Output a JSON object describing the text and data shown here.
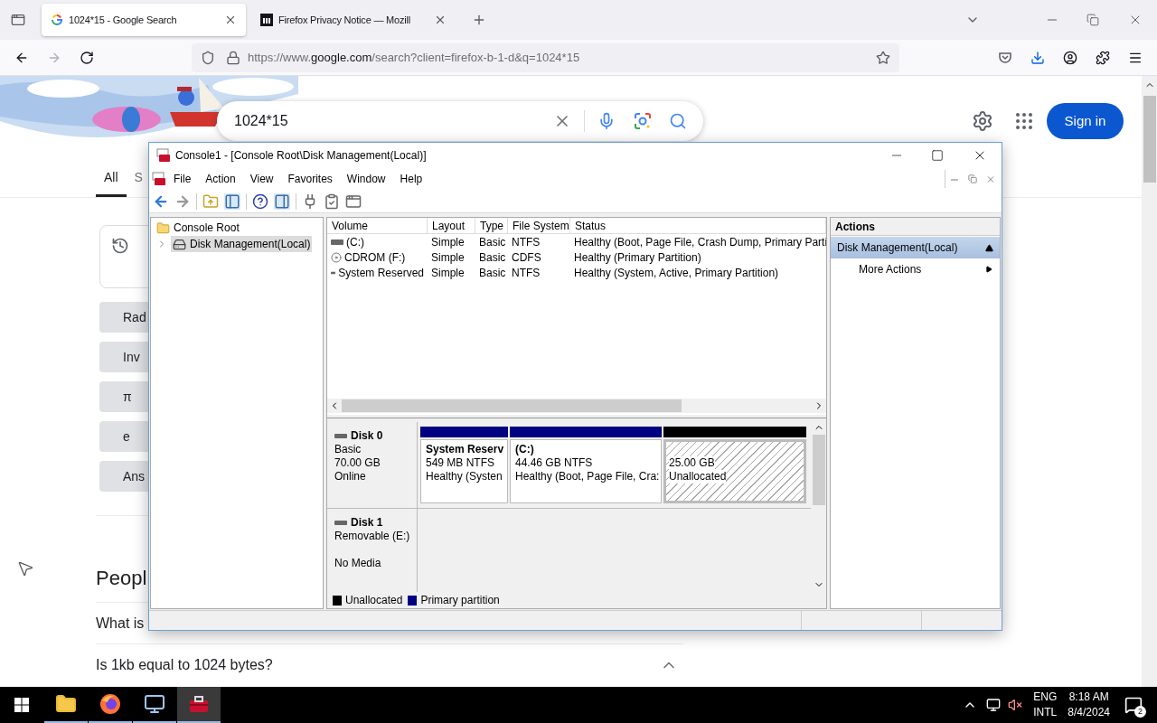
{
  "browser": {
    "tabs": [
      {
        "title": "1024*15 - Google Search",
        "selected": true
      },
      {
        "title": "Firefox Privacy Notice — Mozill",
        "selected": false
      }
    ],
    "url": {
      "scheme": "https://www.",
      "domain": "google.com",
      "rest": "/search?client=firefox-b-1-d&q=1024*15"
    }
  },
  "google": {
    "query": "1024*15",
    "sign_in": "Sign in",
    "tabs": [
      {
        "label": "All",
        "selected": true
      },
      {
        "label": "S",
        "selected": false
      }
    ],
    "calculator_keys": [
      "Rad",
      "Inv",
      "π",
      "e",
      "Ans"
    ],
    "people_also_ask": {
      "heading": "Peopl",
      "questions": [
        "What is",
        "Is 1kb equal to 1024 bytes?"
      ]
    }
  },
  "mmc": {
    "title": "Console1 - [Console Root\\Disk Management(Local)]",
    "menu": [
      "File",
      "Action",
      "View",
      "Favorites",
      "Window",
      "Help"
    ],
    "tree": {
      "label": "Console Root",
      "selected": false,
      "children": [
        {
          "label": "Disk Management(Local)",
          "selected": true
        }
      ]
    },
    "columns": [
      "Volume",
      "Layout",
      "Type",
      "File System",
      "Status"
    ],
    "volumes": [
      {
        "kind": "disk",
        "cells": [
          "(C:)",
          "Simple",
          "Basic",
          "NTFS",
          "Healthy (Boot, Page File, Crash Dump, Primary Parti"
        ]
      },
      {
        "kind": "cdrom",
        "cells": [
          "CDROM (F:)",
          "Simple",
          "Basic",
          "CDFS",
          "Healthy (Primary Partition)"
        ]
      },
      {
        "kind": "disk",
        "cells": [
          "System Reserved",
          "Simple",
          "Basic",
          "NTFS",
          "Healthy (System, Active, Primary Partition)"
        ]
      }
    ],
    "disks": [
      {
        "name": "Disk 0",
        "type": "Basic",
        "size": "70.00 GB",
        "state": "Online",
        "partitions": [
          {
            "kind": "primary",
            "name": "System Reserv",
            "size": "549 MB NTFS",
            "status": "Healthy (Systen"
          },
          {
            "kind": "primary",
            "name": "(C:)",
            "size": "44.46 GB NTFS",
            "status": "Healthy (Boot, Page File, Cra:"
          },
          {
            "kind": "unallocated",
            "size": "25.00 GB",
            "status": "Unallocated"
          }
        ]
      },
      {
        "name": "Disk 1",
        "type": "Removable (E:)",
        "state": "No Media"
      }
    ],
    "legend": [
      {
        "label": "Unallocated",
        "color": "#000000"
      },
      {
        "label": "Primary partition",
        "color": "#000080"
      }
    ],
    "actions": {
      "heading": "Actions",
      "items": [
        {
          "kind": "group",
          "label": "Disk Management(Local)"
        },
        {
          "kind": "submenu",
          "label": "More Actions"
        }
      ]
    }
  },
  "taskbar": {
    "apps": [
      {
        "kind": "folder",
        "selected": false
      },
      {
        "kind": "browser",
        "selected": false
      },
      {
        "kind": "network",
        "selected": false
      },
      {
        "kind": "toolbox",
        "selected": true
      }
    ],
    "language": [
      "ENG",
      "INTL"
    ],
    "time": "8:18 AM",
    "date": "8/4/2024",
    "notifications": "2"
  }
}
